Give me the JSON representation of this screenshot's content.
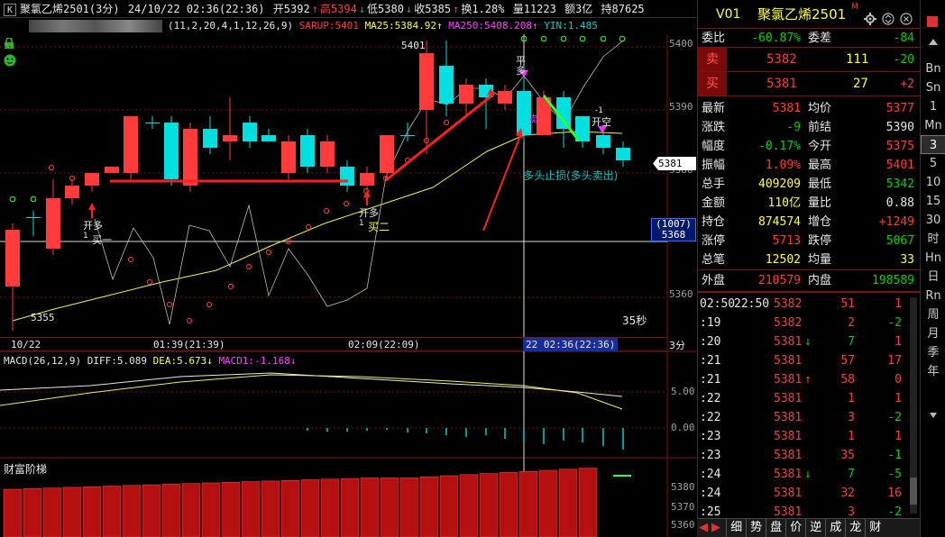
{
  "topbar": {
    "k_icon": "K",
    "instrument": "聚氯乙烯2501(3分)",
    "datetime": "24/10/22 02:36(22:36)",
    "open": "开5392",
    "high": "高5394",
    "low": "低5380",
    "close": "收5385",
    "turnover": "换1.28%",
    "volume": "量11223",
    "amount": "额3亿",
    "position": "持87625"
  },
  "indicators": {
    "params": "(11,2,20,4,1,12,26,9)",
    "sarup": "SARUP:5401",
    "ma25": "MA25:5384.92",
    "ma250": "MA250:5408.208",
    "yin": "YIN:1.485"
  },
  "main_chart": {
    "price_labels": [
      "5400",
      "5390",
      "5380",
      "5360"
    ],
    "high_label": "5401",
    "low_label": "5355",
    "cursor_price": "5381",
    "box_top": "(1007)",
    "box_bottom": "5368",
    "countdown": "35秒",
    "annotations": {
      "kaiduo1": "开多",
      "kaiduo1_num": "1",
      "mai1": "买一",
      "kaiduo2": "开多",
      "kaiduo2_num": "1",
      "mai2": "买二",
      "pingduo": "平多",
      "kaikong": "开空",
      "kaikong_num": "-1",
      "stoploss": "多头止损(多头卖出)",
      "pingkong_mark": "卖"
    }
  },
  "time_axis": {
    "t1": "10/22",
    "t2": "01:39(21:39)",
    "t3": "02:09(22:09)",
    "t4": "22 02:36(22:36)",
    "period": "3分"
  },
  "macd": {
    "label": "MACD(26,12,9)",
    "diff": "DIFF:5.089",
    "dea": "DEA:5.673",
    "macd1": "MACD1:-1.168",
    "scale_top": "5.00",
    "scale_zero": "0.00"
  },
  "ladder": {
    "label": "财富阶梯",
    "scale": [
      "5380",
      "5370",
      "5360"
    ]
  },
  "quote": {
    "v_label": "V01",
    "name": "聚氯乙烯2501",
    "m_tag": "M",
    "weibi_label": "委比",
    "weibi": "-60.87%",
    "weicha_label": "委差",
    "weicha": "-84",
    "sell_label": "卖",
    "sell_price": "5382",
    "sell_vol": "111",
    "sell_chg": "-20",
    "buy_label": "买",
    "buy_price": "5381",
    "buy_vol": "27",
    "buy_chg": "+2",
    "rows": [
      {
        "l1": "最新",
        "v1": "5381",
        "l2": "均价",
        "v2": "5377"
      },
      {
        "l1": "涨跌",
        "v1": "-9",
        "l2": "前结",
        "v2": "5390"
      },
      {
        "l1": "幅度",
        "v1": "-0.17%",
        "l2": "今开",
        "v2": "5375"
      },
      {
        "l1": "振幅",
        "v1": "1.09%",
        "l2": "最高",
        "v2": "5401"
      },
      {
        "l1": "总手",
        "v1": "409209",
        "l2": "最低",
        "v2": "5342"
      },
      {
        "l1": "金额",
        "v1": "110亿",
        "l2": "量比",
        "v2": "0.88"
      },
      {
        "l1": "持仓",
        "v1": "874574",
        "l2": "增仓",
        "v2": "+1249"
      },
      {
        "l1": "涨停",
        "v1": "5713",
        "l2": "跌停",
        "v2": "5067"
      },
      {
        "l1": "总笔",
        "v1": "12502",
        "l2": "均量",
        "v2": "33"
      }
    ],
    "waipan_label": "外盘",
    "waipan": "210579",
    "neipan_label": "内盘",
    "neipan": "198589"
  },
  "trades": [
    {
      "t": "02:50",
      "t2": "22:50",
      "p": "5382",
      "v": "51",
      "c": "1",
      "arrow": ""
    },
    {
      "t": ":19",
      "t2": "",
      "p": "5382",
      "v": "2",
      "c": "-2",
      "arrow": ""
    },
    {
      "t": ":20",
      "t2": "",
      "p": "5381",
      "v": "7",
      "c": "1",
      "arrow": "down"
    },
    {
      "t": ":21",
      "t2": "",
      "p": "5381",
      "v": "57",
      "c": "17",
      "arrow": ""
    },
    {
      "t": ":21",
      "t2": "",
      "p": "5381",
      "v": "58",
      "c": "0",
      "arrow": "up"
    },
    {
      "t": ":22",
      "t2": "",
      "p": "5381",
      "v": "1",
      "c": "1",
      "arrow": ""
    },
    {
      "t": ":22",
      "t2": "",
      "p": "5381",
      "v": "3",
      "c": "-2",
      "arrow": ""
    },
    {
      "t": ":23",
      "t2": "",
      "p": "5381",
      "v": "1",
      "c": "1",
      "arrow": ""
    },
    {
      "t": ":23",
      "t2": "",
      "p": "5381",
      "v": "35",
      "c": "-1",
      "arrow": ""
    },
    {
      "t": ":24",
      "t2": "",
      "p": "5381",
      "v": "7",
      "c": "-5",
      "arrow": "down"
    },
    {
      "t": ":24",
      "t2": "",
      "p": "5381",
      "v": "32",
      "c": "16",
      "arrow": ""
    },
    {
      "t": ":25",
      "t2": "",
      "p": "5381",
      "v": "3",
      "c": "-2",
      "arrow": ""
    }
  ],
  "bottom_tabs": [
    "细",
    "势",
    "盘",
    "价",
    "逆",
    "成",
    "龙",
    "财"
  ],
  "side_nav": [
    "Bn",
    "Sn",
    "1",
    "Mn",
    "3",
    "5",
    "10",
    "15",
    "30",
    "时",
    "Hn",
    "日",
    "Rn",
    "周",
    "月",
    "季",
    "年"
  ],
  "side_nav_active": "3",
  "colors": {
    "up": "#ff3b3b",
    "down": "#00e0e0",
    "ma": "#ffff50",
    "grid": "#7a1414"
  }
}
